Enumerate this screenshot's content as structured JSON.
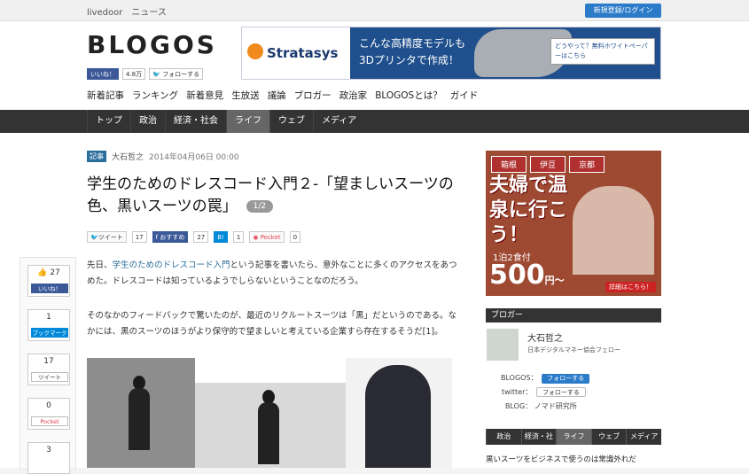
{
  "topbar": {
    "site": "livedoor　ニュース",
    "login": "新規登録/ログイン"
  },
  "logo": "BLOGOS",
  "logo_social": {
    "fb_like": "いいね！",
    "fb_count": "4.8万",
    "tw_follow": "フォローする"
  },
  "ad_top": {
    "brand": "Stratasys",
    "line1": "こんな高精度モデルも",
    "line2": "3Dプリンタで作成！",
    "cta": "どうやって？無料ホワイトペーパーはこちら"
  },
  "nav1": [
    "新着記事",
    "ランキング",
    "新着意見",
    "生放送",
    "議論",
    "ブロガー",
    "政治家",
    "BLOGOSとは？",
    "ガイド"
  ],
  "nav2": [
    "トップ",
    "政治",
    "経済・社会",
    "ライフ",
    "ウェブ",
    "メディア"
  ],
  "article": {
    "tag": "記事",
    "author": "大石哲之",
    "date": "2014年04月06日 00:00",
    "title_line1": "学生のためのドレスコード入門２-「望ましいスーツの",
    "title_line2": "色、黒いスーツの罠」",
    "page": "1/2",
    "share": {
      "tweet": "ツイート",
      "tweet_count": "17",
      "fb": "おすすめ",
      "fb_count": "27",
      "hb": "B!",
      "hb_count": "1",
      "pocket": "Pocket",
      "pocket_count": "0"
    },
    "para1_pre": "先日、",
    "para1_link": "学生のためのドレスコード入門",
    "para1_post": "という記事を書いたら、意外なことに多くのアクセスをあつめた。ドレスコードは知っているようでしらないということなのだろう。",
    "para2": "そのなかのフィードバックで驚いたのが、最近のリクルートスーツは「黒」だというのである。なかには、黒のスーツのほうがより保守的で望ましいと考えている企業すら存在するそうだ[1]。"
  },
  "leftshare": {
    "like_count": "27",
    "like_label": "いいね！",
    "hb_count": "1",
    "hb_label": "ブックマーク",
    "tw_count": "17",
    "tw_label": "ツイート",
    "pk_count": "0",
    "pk_label": "Pocket",
    "extra_count": "3"
  },
  "right_ad": {
    "tabs": [
      "箱根",
      "伊豆",
      "京都"
    ],
    "headline": "夫婦で温泉に行こう！",
    "plan": "1泊2食付",
    "price": "500",
    "yen": "円〜",
    "cta": "詳細はこちら！"
  },
  "blogger": {
    "heading": "ブロガー",
    "name": "大石哲之",
    "role": "日本デジタルマネー協会フェロー",
    "blogos_label": "BLOGOS：",
    "blogos_follow": "フォローする",
    "twitter_label": "twitter：",
    "twitter_follow": "フォローする",
    "blog_label": "BLOG：",
    "blog_name": "ノマド研究所"
  },
  "right_nav": [
    "政治",
    "経済・社会",
    "ライフ",
    "ウェブ",
    "メディア"
  ],
  "right_text": "黒いスーツをビジネスで使うのは常識外れだ"
}
